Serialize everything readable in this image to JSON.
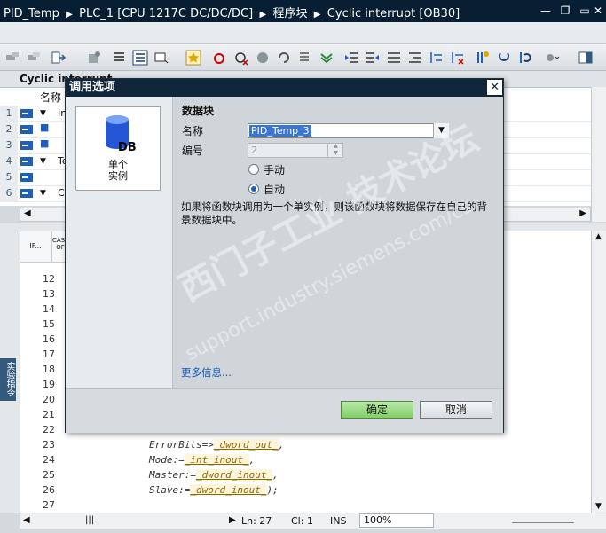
{
  "title_bar": {
    "crumbs": [
      "PID_Temp",
      "PLC_1 [CPU 1217C DC/DC/DC]",
      "程序块",
      "Cyclic interrupt [OB30]"
    ]
  },
  "block_title": "Cyclic interrupt",
  "interface_table": {
    "header_name": "名称",
    "rows": [
      {
        "num": "1",
        "text": "In",
        "expand": true
      },
      {
        "num": "2",
        "text": "",
        "expand": false
      },
      {
        "num": "3",
        "text": "",
        "expand": false
      },
      {
        "num": "4",
        "text": "Te",
        "expand": true
      },
      {
        "num": "5",
        "text": "",
        "expand": false
      },
      {
        "num": "6",
        "text": "C",
        "expand": true
      }
    ]
  },
  "instruction_tabs": {
    "tab1": "IF...",
    "tab2": "CASE OF"
  },
  "side_label": "实验指令",
  "code": {
    "line_numbers": [
      "12",
      "13",
      "14",
      "15",
      "16",
      "17",
      "18",
      "19",
      "20",
      "21",
      "22",
      "23",
      "24",
      "25",
      "26",
      "27"
    ],
    "lines": [
      {
        "num": "23",
        "param": "ErrorBits",
        "op": "=>",
        "value": "_dword_out_",
        "end": ","
      },
      {
        "num": "24",
        "param": "Mode",
        "op": ":=",
        "value": "_int_inout_",
        "end": ","
      },
      {
        "num": "25",
        "param": "Master",
        "op": ":=",
        "value": "_dword_inout_",
        "end": ","
      },
      {
        "num": "26",
        "param": "Slave",
        "op": ":=",
        "value": "_dword_inout_",
        "end": ");"
      }
    ]
  },
  "status": {
    "ln": "Ln: 27",
    "cl": "Cl: 1",
    "ins": "INS",
    "zoom": "100%"
  },
  "dialog": {
    "title": "调用选项",
    "tile_label_line1": "单个",
    "tile_label_line2": "实例",
    "db_badge": "DB",
    "section_title": "数据块",
    "name_label": "名称",
    "name_value": "PID_Temp_3",
    "number_label": "编号",
    "number_value": "2",
    "radio_manual": "手动",
    "radio_auto": "自动",
    "selected_radio": "auto",
    "description": "如果将函数块调用为一个单实例，则该函数块将数据保存在自己的背景数据块中。",
    "more_info": "更多信息...",
    "ok_label": "确定",
    "cancel_label": "取消"
  },
  "watermark": {
    "line1": "西门子工业 技术论坛",
    "line2": "support.industry.siemens.com/cs"
  },
  "colors": {
    "title_bar_bg": "#071e33",
    "dialog_title_bg": "#10263b",
    "ok_button": "#8fd676",
    "link": "#1457b5"
  }
}
